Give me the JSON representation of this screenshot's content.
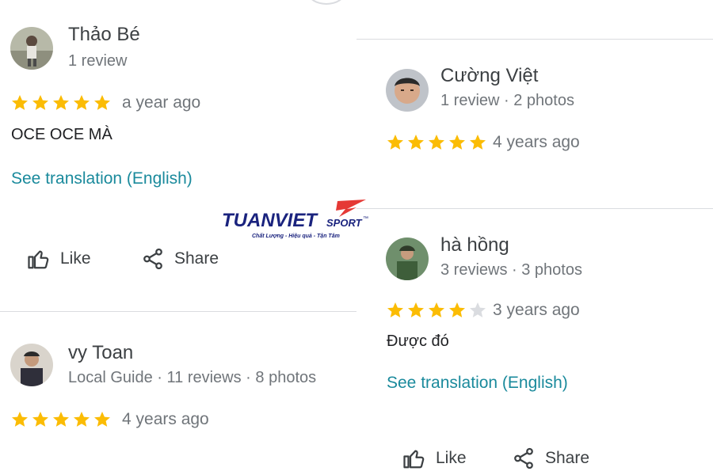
{
  "reviews": [
    {
      "name": "Thảo Bé",
      "meta": "1 review",
      "rating": 5,
      "time": "a year ago",
      "text": "OCE OCE MÀ",
      "translate": "See translation (English)",
      "like": "Like",
      "share": "Share"
    },
    {
      "name": "vy Toan",
      "meta": "Local Guide · 11 reviews · 8 photos",
      "rating": 5,
      "time": "4 years ago"
    },
    {
      "name": "Cường Việt",
      "meta": "1 review · 2 photos",
      "rating": 5,
      "time": "4 years ago"
    },
    {
      "name": "hà hồng",
      "meta": "3 reviews · 3 photos",
      "rating": 4,
      "time": "3 years ago",
      "text": "Được đó",
      "translate": "See translation (English)",
      "like": "Like",
      "share": "Share"
    }
  ],
  "watermark": {
    "brand": "TUANVIET",
    "brand_suffix": "SPORT",
    "tm": "™",
    "tagline": "Chất Lượng - Hiệu quả - Tận Tâm"
  },
  "colors": {
    "star_filled": "#fbbc04",
    "star_empty": "#dadce0",
    "link": "#1a8a9c",
    "brand_red": "#e53935",
    "brand_navy": "#1a237e"
  },
  "icons": {
    "like": "thumbs-up-icon",
    "share": "share-icon"
  }
}
